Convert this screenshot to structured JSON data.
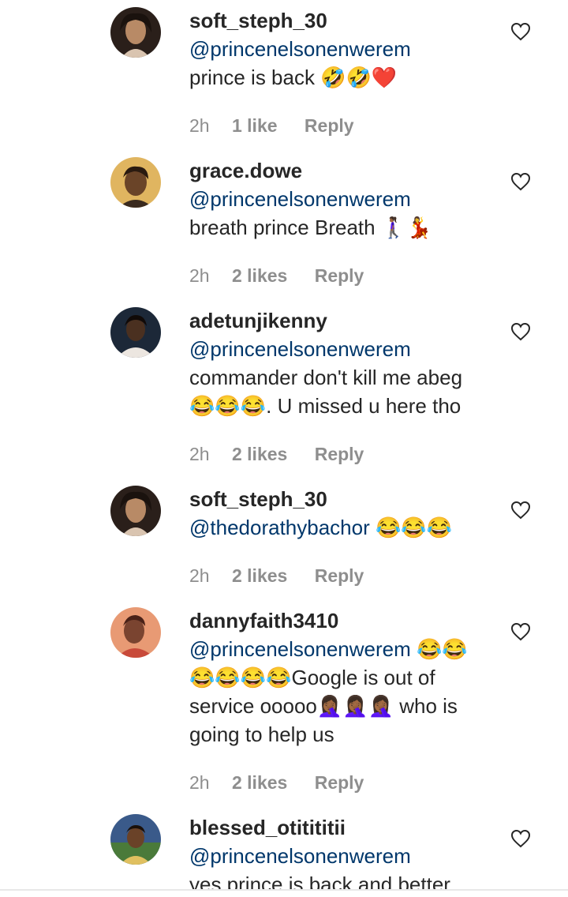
{
  "comments": [
    {
      "username": "soft_steph_30",
      "mention": "@princenelsonenwerem",
      "text_lines": [
        "prince is back 🤣🤣❤️"
      ],
      "time": "2h",
      "likes": "1 like",
      "reply": "Reply",
      "avatar_colors": [
        "#3a2a22",
        "#c9a98a"
      ]
    },
    {
      "username": "grace.dowe",
      "mention": "@princenelsonenwerem",
      "text_lines": [
        "breath prince Breath 🚶🏾‍♀️💃"
      ],
      "time": "2h",
      "likes": "2 likes",
      "reply": "Reply",
      "avatar_colors": [
        "#d7a64c",
        "#5a3a22"
      ]
    },
    {
      "username": "adetunjikenny",
      "mention": "@princenelsonenwerem",
      "text_lines": [
        "commander don't kill me abeg",
        "😂😂😂. U missed u here tho"
      ],
      "time": "2h",
      "likes": "2 likes",
      "reply": "Reply",
      "avatar_colors": [
        "#1e2a3a",
        "#e8e2dc"
      ]
    },
    {
      "username": "soft_steph_30",
      "mention": "@thedorathybachor",
      "mention_suffix": " 😂😂😂",
      "text_lines": [],
      "time": "2h",
      "likes": "2 likes",
      "reply": "Reply",
      "avatar_colors": [
        "#3a2a22",
        "#c9a98a"
      ]
    },
    {
      "username": "dannyfaith3410",
      "mention": "@princenelsonenwerem",
      "mention_suffix": " 😂😂",
      "text_lines": [
        "😂😂😂😂Google is out of",
        "service ooooo🤦🏾‍♀️🤦🏾‍♀️🤦🏾‍♀️ who is",
        "going to help us"
      ],
      "time": "2h",
      "likes": "2 likes",
      "reply": "Reply",
      "avatar_colors": [
        "#d88a6a",
        "#7a3a2a"
      ]
    },
    {
      "username": "blessed_otitititii",
      "mention": "@princenelsonenwerem",
      "text_lines": [
        "yes prince is back and better"
      ],
      "avatar_colors": [
        "#3a5a8a",
        "#e0c060"
      ]
    }
  ],
  "icons": {
    "heart": "heart-outline-icon"
  }
}
